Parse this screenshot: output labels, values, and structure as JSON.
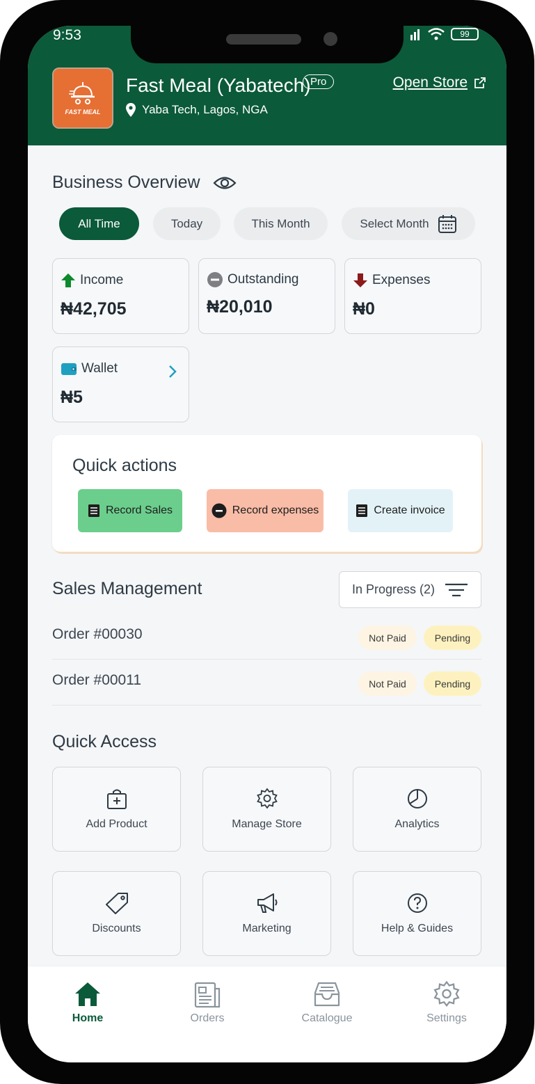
{
  "status_bar": {
    "time": "9:53",
    "battery": "99"
  },
  "store": {
    "name": "Fast Meal (Yabatech)",
    "badge": "Pro",
    "location": "Yaba Tech, Lagos, NGA",
    "logo_text": "FAST MEAL",
    "open_store_label": "Open Store"
  },
  "overview": {
    "title": "Business Overview",
    "filters": [
      "All Time",
      "Today",
      "This Month",
      "Select Month"
    ],
    "active_filter": "All Time",
    "cards": {
      "income": {
        "label": "Income",
        "value": "₦42,705"
      },
      "outstanding": {
        "label": "Outstanding",
        "value": "₦20,010"
      },
      "expenses": {
        "label": "Expenses",
        "value": "₦0"
      },
      "wallet": {
        "label": "Wallet",
        "value": "₦5"
      }
    }
  },
  "quick_actions": {
    "title": "Quick actions",
    "record_sales": "Record Sales",
    "record_expenses": "Record expenses",
    "create_invoice": "Create invoice"
  },
  "sales": {
    "title": "Sales Management",
    "filter_label": "In Progress (2)",
    "orders": [
      {
        "label": "Order #00030",
        "payment": "Not Paid",
        "status": "Pending"
      },
      {
        "label": "Order #00011",
        "payment": "Not Paid",
        "status": "Pending"
      }
    ]
  },
  "quick_access": {
    "title": "Quick Access",
    "tiles": [
      "Add Product",
      "Manage Store",
      "Analytics",
      "Discounts",
      "Marketing",
      "Help & Guides"
    ]
  },
  "nav": {
    "items": [
      "Home",
      "Orders",
      "Catalogue",
      "Settings"
    ],
    "active": "Home"
  },
  "colors": {
    "brand_green": "#0b5a3a",
    "record_sales_bg": "#6cce8c",
    "record_expenses_bg": "#f9bca7",
    "create_invoice_bg": "#e3f2f7",
    "wallet_icon": "#1fa0c0",
    "income_arrow": "#0c8a2c",
    "expenses_arrow": "#8b1a1a"
  }
}
